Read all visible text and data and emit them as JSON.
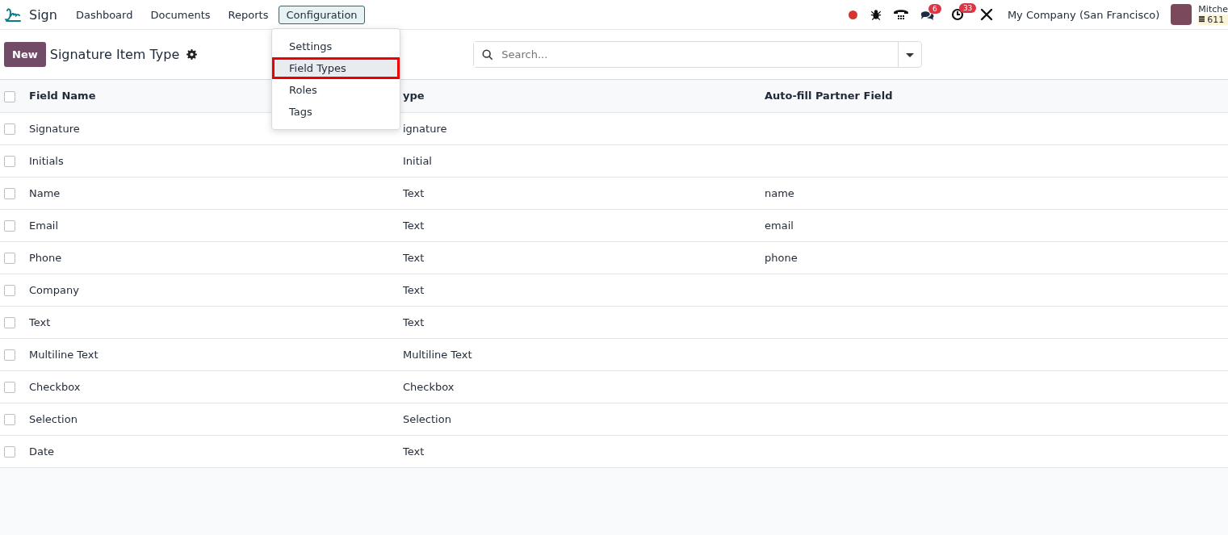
{
  "navbar": {
    "app_name": "Sign",
    "menu": [
      {
        "label": "Dashboard",
        "selected": false
      },
      {
        "label": "Documents",
        "selected": false
      },
      {
        "label": "Reports",
        "selected": false
      },
      {
        "label": "Configuration",
        "selected": true
      }
    ],
    "systray": {
      "messages_count": "6",
      "activities_count": "33",
      "company": "My Company (San Francisco)",
      "user_name": "Mitche",
      "user_credits": "611"
    }
  },
  "configuration_menu": [
    {
      "label": "Settings",
      "selected": false
    },
    {
      "label": "Field Types",
      "selected": true
    },
    {
      "label": "Roles",
      "selected": false
    },
    {
      "label": "Tags",
      "selected": false
    }
  ],
  "control_panel": {
    "new_button": "New",
    "breadcrumb": "Signature Item Type",
    "search": {
      "placeholder": "Search..."
    }
  },
  "table": {
    "select_all_checked": false,
    "columns": [
      "Field Name",
      "ype",
      "Auto-fill Partner Field"
    ],
    "rows": [
      {
        "cells": [
          "Signature",
          "ignature",
          ""
        ],
        "checked": false
      },
      {
        "cells": [
          "Initials",
          "Initial",
          ""
        ],
        "checked": false
      },
      {
        "cells": [
          "Name",
          "Text",
          "name"
        ],
        "checked": false
      },
      {
        "cells": [
          "Email",
          "Text",
          "email"
        ],
        "checked": false
      },
      {
        "cells": [
          "Phone",
          "Text",
          "phone"
        ],
        "checked": false
      },
      {
        "cells": [
          "Company",
          "Text",
          ""
        ],
        "checked": false
      },
      {
        "cells": [
          "Text",
          "Text",
          ""
        ],
        "checked": false
      },
      {
        "cells": [
          "Multiline Text",
          "Multiline Text",
          ""
        ],
        "checked": false
      },
      {
        "cells": [
          "Checkbox",
          "Checkbox",
          ""
        ],
        "checked": false
      },
      {
        "cells": [
          "Selection",
          "Selection",
          ""
        ],
        "checked": false
      },
      {
        "cells": [
          "Date",
          "Text",
          ""
        ],
        "checked": false
      }
    ]
  }
}
